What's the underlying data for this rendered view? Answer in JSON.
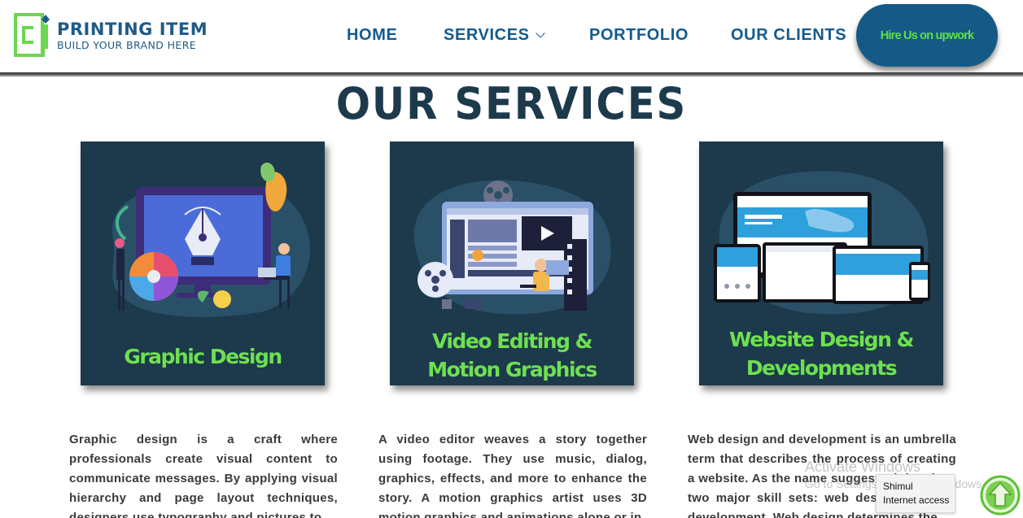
{
  "header": {
    "logo": {
      "title": "PRINTING ITEM",
      "subtitle": "BUILD YOUR BRAND HERE"
    },
    "nav": {
      "home": "HOME",
      "services": "SERVICES",
      "portfolio": "PORTFOLIO",
      "clients": "OUR CLIENTS"
    },
    "hire_button": "Hire Us on upwork"
  },
  "section": {
    "title": "OUR SERVICES"
  },
  "cards": [
    {
      "label_lines": [
        "Graphic Design"
      ],
      "icon": "graphic-design-illustration"
    },
    {
      "label_lines": [
        "Video Editing &",
        "Motion Graphics"
      ],
      "icon": "video-editing-illustration"
    },
    {
      "label_lines": [
        "Website Design &",
        "Developments"
      ],
      "icon": "responsive-website-illustration"
    }
  ],
  "descriptions": [
    "Graphic design is a craft where professionals create visual content to communicate messages. By applying visual hierarchy and page layout techniques, designers use typography and pictures to",
    "A video editor weaves a story together using footage. They use music, dialog, graphics, effects, and more to enhance the story. A motion graphics artist uses 3D motion graphics and animations alone or in",
    "Web design and development is an umbrella term that describes the process of creating a website. As the name suggests, it involves two major skill sets: web design and web development. Web design determines the"
  ],
  "overlays": {
    "watermark_title": "Activate Windows",
    "watermark_sub": "Go to Settings to activate Windows.",
    "tooltip_line1": "Shimul",
    "tooltip_line2": "Internet access"
  },
  "colors": {
    "brand_blue": "#155a86",
    "accent_green": "#6ee050",
    "card_bg": "#1c3a4b",
    "title_dark": "#1c3a4b"
  }
}
